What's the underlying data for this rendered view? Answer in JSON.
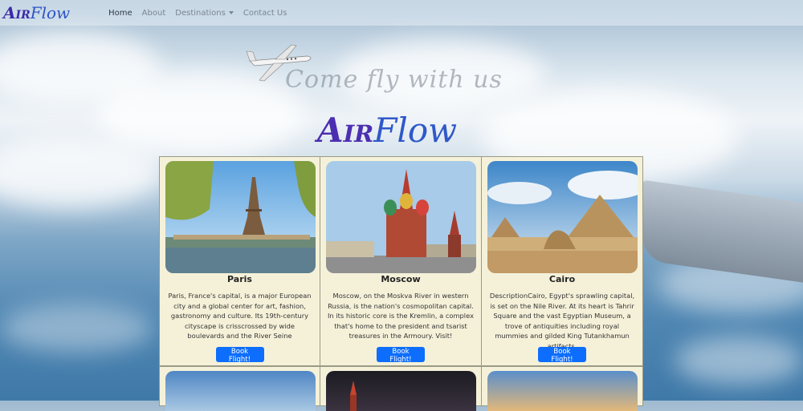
{
  "navbar": {
    "brand_air": "Air",
    "brand_flow": "Flow",
    "links": [
      {
        "label": "Home"
      },
      {
        "label": "About"
      },
      {
        "label": "Destinations"
      },
      {
        "label": "Contact Us"
      }
    ]
  },
  "hero": {
    "tagline": "Come fly with us",
    "logo_air": "Air",
    "logo_flow": "Flow"
  },
  "cards": [
    {
      "title": "Paris",
      "description": "Paris, France's capital, is a major European city and a global center for art, fashion, gastronomy and culture. Its 19th-century cityscape is crisscrossed by wide boulevards and the River Seine",
      "button": "Book Flight!"
    },
    {
      "title": "Moscow",
      "description": "Moscow, on the Moskva River in western Russia, is the nation's cosmopolitan capital. In its historic core is the Kremlin, a complex that's home to the president and tsarist treasures in the Armoury. Visit!",
      "button": "Book Flight!"
    },
    {
      "title": "Cairo",
      "description": "DescriptionCairo, Egypt's sprawling capital, is set on the Nile River. At its heart is Tahrir Square and the vast Egyptian Museum, a trove of antiquities including royal mummies and gilded King Tutankhamun artifacts.",
      "button": "Book Flight!"
    }
  ],
  "colors": {
    "button": "#0d6efd",
    "card_bg": "#f5f1d9",
    "brand_air": "#3b2aa8",
    "brand_flow": "#2e54c7"
  }
}
